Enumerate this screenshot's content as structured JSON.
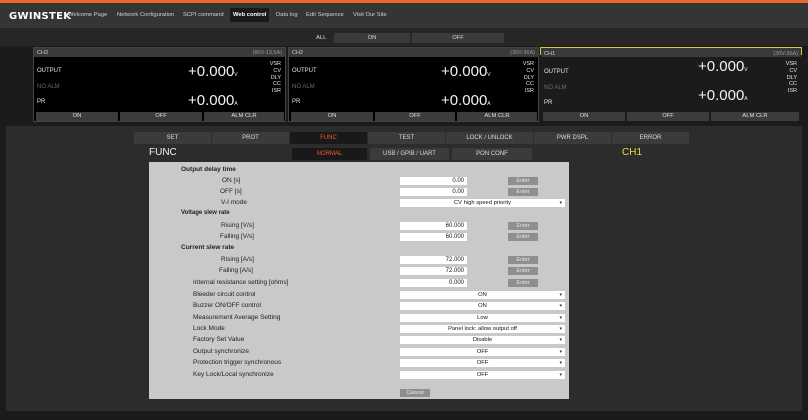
{
  "nav": {
    "logo": "GWINSTEK",
    "items": [
      "Welcome Page",
      "Network Configuration",
      "SCPI command",
      "Web control",
      "Data log",
      "Edit Sequence",
      "Visit Our Site"
    ],
    "active": "Web control"
  },
  "all_bar": {
    "label": "ALL",
    "on": "ON",
    "off": "OFF"
  },
  "channels": [
    {
      "name": "CH3",
      "range": "(80V-13.5A)",
      "output": "OUTPUT",
      "v": "+0.000",
      "v_unit": "V",
      "alm": "NO ALM",
      "pr": "PR",
      "a": "+0.000",
      "a_unit": "A",
      "status": [
        "VSR",
        "CV",
        "DLY",
        "CC",
        "ISR"
      ],
      "on": "ON",
      "off": "OFF",
      "alm_clr": "ALM CLR"
    },
    {
      "name": "CH2",
      "range": "(30V-36A)",
      "output": "OUTPUT",
      "v": "+0.000",
      "v_unit": "V",
      "alm": "NO ALM",
      "pr": "PR",
      "a": "+0.000",
      "a_unit": "A",
      "status": [
        "VSR",
        "CV",
        "DLY",
        "CC",
        "ISR"
      ],
      "on": "ON",
      "off": "OFF",
      "alm_clr": "ALM CLR"
    },
    {
      "name": "CH1",
      "range": "(30V-36A)",
      "output": "OUTPUT",
      "v": "+0.000",
      "v_unit": "V",
      "alm": "NO ALM",
      "pr": "PR",
      "a": "+0.000",
      "a_unit": "A",
      "status": [
        "VSR",
        "CV",
        "DLY",
        "CC",
        "ISR"
      ],
      "on": "ON",
      "off": "OFF",
      "alm_clr": "ALM CLR"
    }
  ],
  "tabs": [
    "SET",
    "PROT",
    "FUNC",
    "TEST",
    "LOCK / UNLOCK",
    "PWR DSPL",
    "ERROR"
  ],
  "active_tab": "FUNC",
  "func_title": "FUNC",
  "subtabs": [
    "NORMAL",
    "USB / GPIB / UART",
    "PON CONF"
  ],
  "active_subtab": "NORMAL",
  "selected_channel": "CH1",
  "form": {
    "output_delay_title": "Output delay time",
    "on_label": "ON [s]",
    "on_value": "0.00",
    "off_label": "OFF [s]",
    "off_value": "0.00",
    "vi_label": "V-I mode",
    "vi_value": "CV high speed priority",
    "vslew_title": "Voltage slew rate",
    "v_rising_label": "Rising [V/s]",
    "v_rising_value": "60.000",
    "v_falling_label": "Falling [V/s]",
    "v_falling_value": "60.000",
    "cslew_title": "Current slew rate",
    "c_rising_label": "Rising [A/s]",
    "c_rising_value": "72.000",
    "c_falling_label": "Falling [A/s]",
    "c_falling_value": "72.000",
    "ir_label": "Internal resistance setting [ohms]",
    "ir_value": "0.000",
    "bleeder_label": "Bleeder circuit control",
    "bleeder_value": "ON",
    "buzzer_label": "Buzzer ON/OFF control",
    "buzzer_value": "ON",
    "avg_label": "Measurement Average Setting",
    "avg_value": "Low",
    "lock_label": "Lock Mode",
    "lock_value": "Panel lock: allow output off",
    "factory_label": "Factory Set Value",
    "factory_value": "Disable",
    "outsync_label": "Output synchronize",
    "outsync_value": "OFF",
    "protsync_label": "Protection trigger synchronous",
    "protsync_value": "OFF",
    "keysync_label": "Key Lock/Local synchronize",
    "keysync_value": "OFF",
    "enter_label": "Enter",
    "cancel_label": "Cancel"
  },
  "colors": {
    "accent": "#f05a2a",
    "selected_channel": "#d4c83a",
    "stripe": "#e8672a"
  }
}
